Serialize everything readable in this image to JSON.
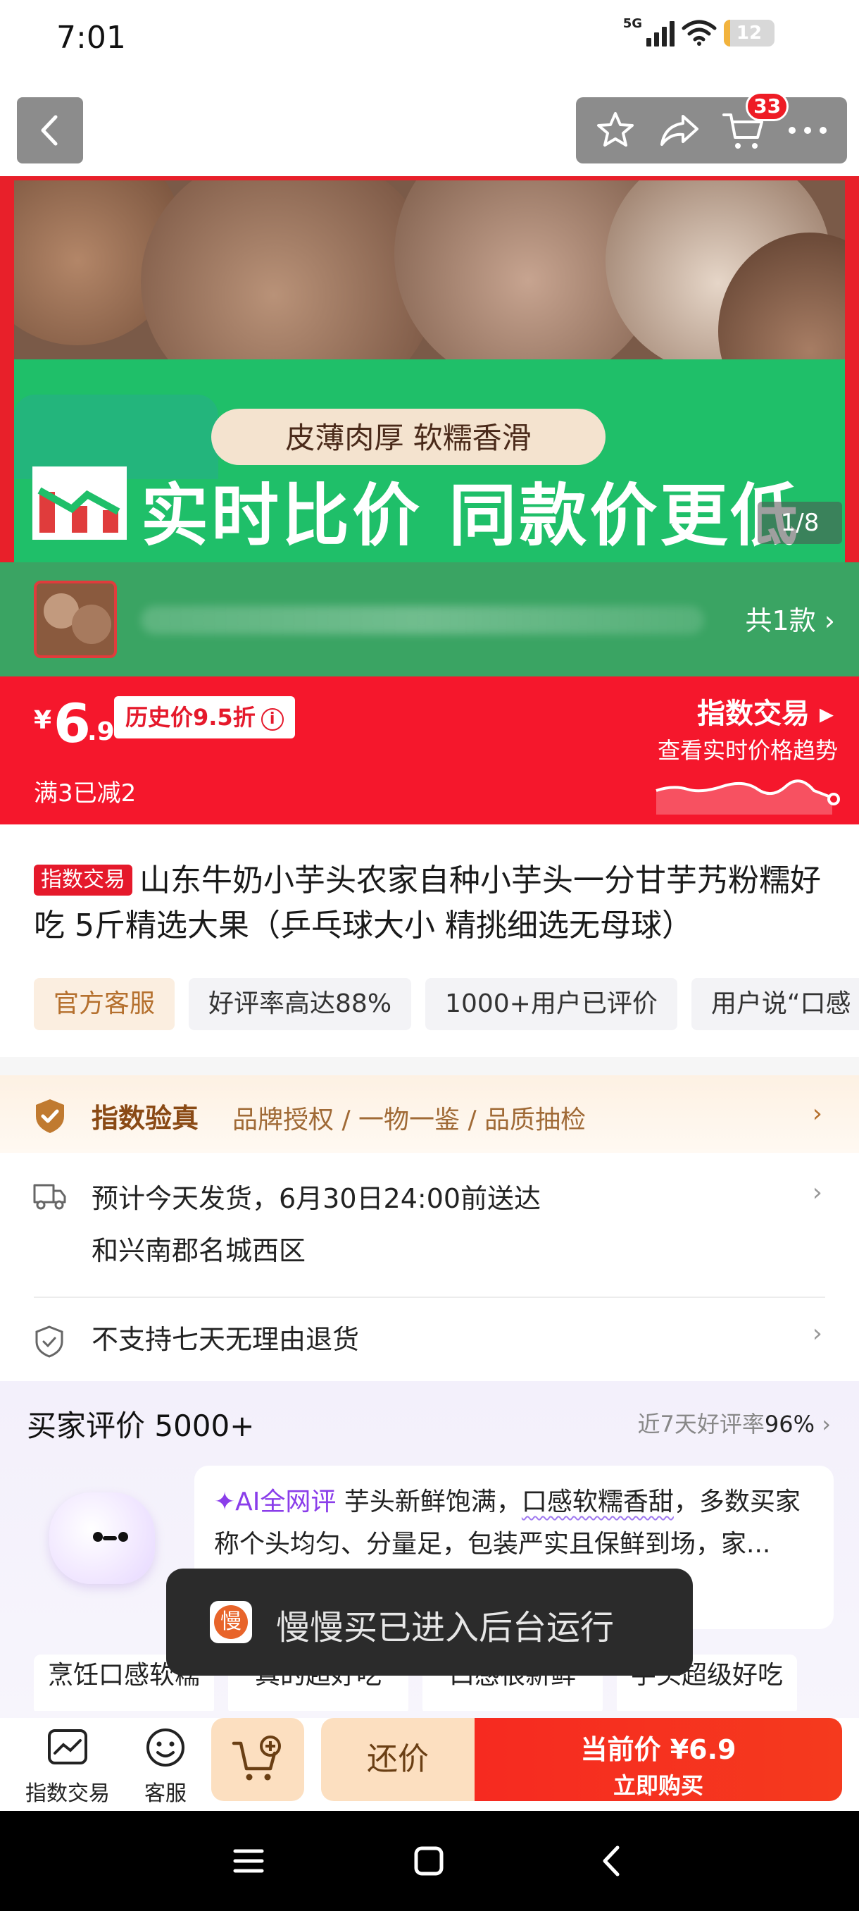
{
  "status_bar": {
    "time": "7:01",
    "network": "5G",
    "battery": "12",
    "battery_fraction": 0.12
  },
  "top_bar": {
    "cart_badge": "33"
  },
  "hero": {
    "tagline": "皮薄肉厚 软糯香滑",
    "banner": "实时比价 同款价更低",
    "pager": "1/8"
  },
  "variants": {
    "count_label": "共1款"
  },
  "price": {
    "currency": "¥",
    "integer": "6",
    "decimal": ".9",
    "history_tag": "历史价9.5折",
    "promo": "满3已减2",
    "index_label": "指数交易",
    "trend_label": "查看实时价格趋势"
  },
  "product": {
    "badge": "指数交易",
    "title": "山东牛奶小芋头农家自种小芋头一分甘芋艿粉糯好吃 5斤精选大果（乒乓球大小 精挑细选无母球）"
  },
  "chips": [
    "官方客服",
    "好评率高达88%",
    "1000+用户已评价",
    "用户说“口感"
  ],
  "verify": {
    "title": "指数验真",
    "details": "品牌授权 / 一物一鉴 / 品质抽检"
  },
  "shipping": {
    "line1": "预计今天发货，6月30日24:00前送达",
    "line2": "和兴南郡名城西区"
  },
  "returns": {
    "text": "不支持七天无理由退货"
  },
  "reviews": {
    "heading": "买家评价 5000+",
    "rate_label": "近7天好评率",
    "rate_value": "96%",
    "ai_label": "✦AI全网评",
    "ai_text_1": " 芋头新鲜饱满，",
    "ai_text_hl": "口感软糯香甜",
    "ai_text_2": "，多数买家称个头均匀、分量足，包装严实且保鲜到",
    "ai_text_3": "场，家...",
    "tags": [
      "烹饪口感软糯",
      "真的超好吃",
      "口感很新鲜",
      "芋头超级好吃"
    ]
  },
  "toast": {
    "message": "慢慢买已进入后台运行"
  },
  "bottom_bar": {
    "index_label": "指数交易",
    "service_label": "客服",
    "bargain_label": "还价",
    "buy_price": "当前价 ¥6.9",
    "buy_label": "立即购买"
  },
  "colors": {
    "accent_red": "#f5172c",
    "banner_green": "#1fbf69",
    "gold": "#b5702e"
  }
}
